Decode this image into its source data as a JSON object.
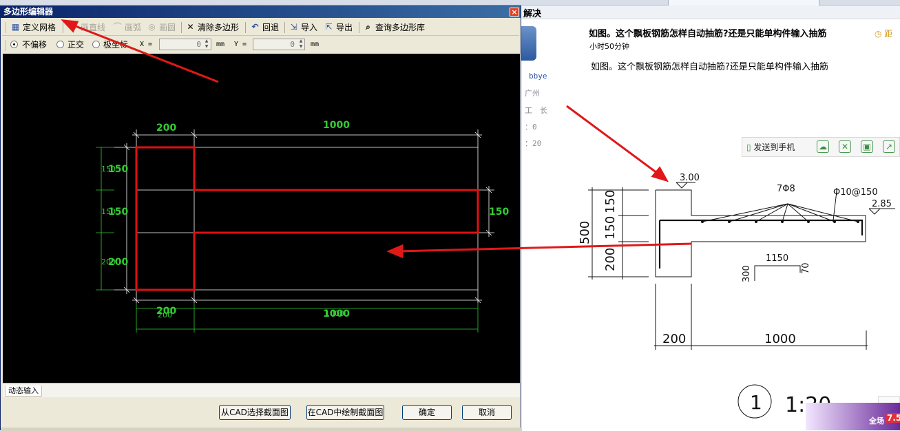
{
  "background": {
    "header_text": "解决",
    "question": {
      "title": "如图。这个飘板钢筋怎样自动抽筋?还是只能单构件输入抽筋",
      "time": "小时50分钟",
      "body": "如图。这个飘板钢筋怎样自动抽筋?还是只能单构件输入抽筋",
      "distance": "距"
    },
    "user": {
      "name": "bbye",
      "city": "广州",
      "role": "工　长",
      "stat1": "：0",
      "stat2": "：20"
    },
    "share": {
      "send_to_phone": "发送到手机"
    },
    "drawing": {
      "elev_top": "3.00",
      "elev_right": "2.85",
      "rebar_main": "7Φ8",
      "rebar_dist": "Φ10@150",
      "dim_total": "500",
      "dim_a": "150",
      "dim_b": "150",
      "dim_c": "200",
      "hook_len": "1150",
      "hook_left": "300",
      "hook_right": "70",
      "bottom_a": "200",
      "bottom_b": "1000",
      "scale_index": "1",
      "scale_text": "1:20"
    },
    "promo": {
      "label": "全场",
      "value": "7.5"
    }
  },
  "dialog": {
    "title": "多边形编辑器",
    "toolbar": {
      "define_grid": "定义网格",
      "draw_line": "画直线",
      "draw_arc": "画弧",
      "draw_circle": "画圆",
      "clear_polygon": "清除多边形",
      "undo": "回退",
      "import": "导入",
      "export": "导出",
      "query_library": "查询多边形库"
    },
    "options": {
      "no_offset": "不偏移",
      "orthogonal": "正交",
      "polar": "极坐标",
      "x_label": "X =",
      "x_value": "0",
      "x_unit": "mm",
      "y_label": "Y =",
      "y_value": "0",
      "y_unit": "mm"
    },
    "canvas": {
      "top_dims": [
        "200",
        "1000"
      ],
      "bottom_dims": [
        "200",
        "1000"
      ],
      "bottom_dims_ghost": [
        "200",
        "1000"
      ],
      "left_dims": [
        "150",
        "150",
        "200"
      ],
      "left_dims_ghost": [
        "150",
        "150",
        "200"
      ],
      "right_dim": "150",
      "grid_color": "#ffffff",
      "dim_color": "#33cc33",
      "polygon_color": "#e01010"
    },
    "status_tab": "动态输入",
    "buttons": {
      "select_from_cad": "从CAD选择截面图",
      "draw_in_cad": "在CAD中绘制截面图",
      "ok": "确定",
      "cancel": "取消"
    }
  },
  "annotations": {
    "arrow_color": "#e01818"
  }
}
